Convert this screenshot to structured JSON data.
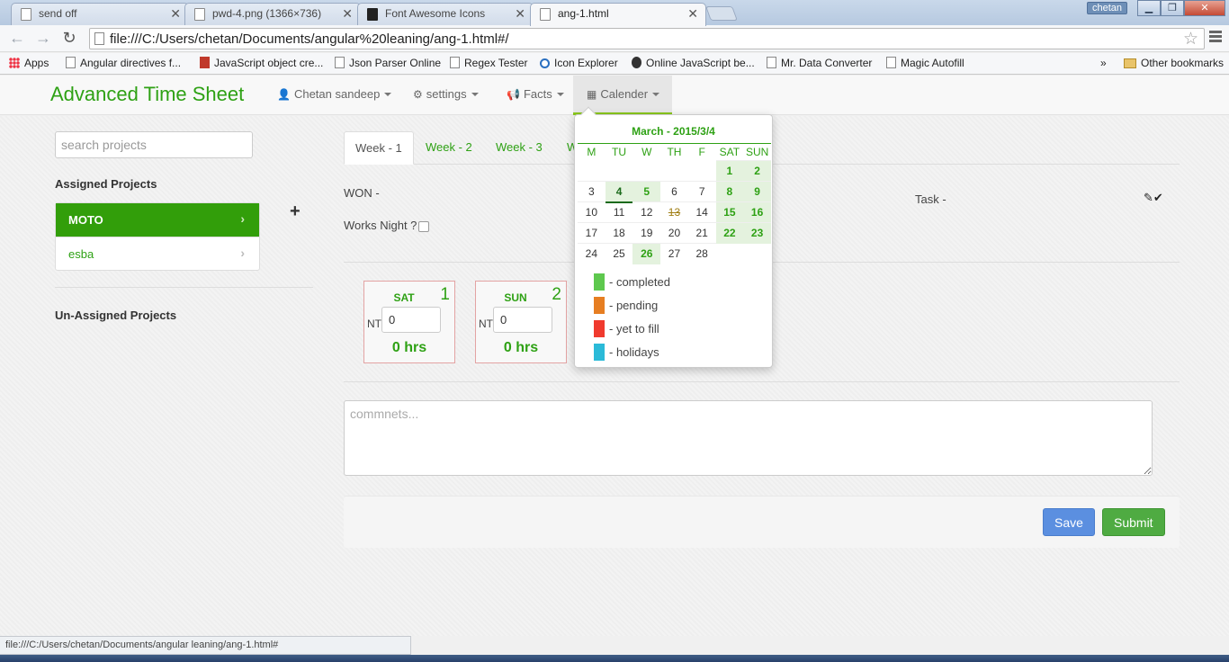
{
  "browser": {
    "tabs": [
      {
        "title": "send off"
      },
      {
        "title": "pwd-4.png (1366×736)"
      },
      {
        "title": "Font Awesome Icons"
      },
      {
        "title": "ang-1.html"
      }
    ],
    "profile_name": "chetan",
    "url": "file:///C:/Users/chetan/Documents/angular%20leaning/ang-1.html#/",
    "bookmarks": [
      "Apps",
      "Angular directives f...",
      "JavaScript object cre...",
      "Json Parser Online",
      "Regex Tester",
      "Icon Explorer",
      "Online JavaScript be...",
      "Mr. Data Converter",
      "Magic Autofill"
    ],
    "bookmarks_overflow": "»",
    "other_bookmarks": "Other bookmarks"
  },
  "app": {
    "brand": "Advanced Time Sheet",
    "nav": {
      "user": "Chetan sandeep",
      "settings": "settings",
      "facts": "Facts",
      "calender": "Calender"
    }
  },
  "sidebar": {
    "search_placeholder": "search projects",
    "assigned_heading": "Assigned Projects",
    "projects": [
      "MOTO",
      "esba"
    ],
    "unassigned_heading": "Un-Assigned Projects"
  },
  "main": {
    "tabs": [
      "Week - 1",
      "Week - 2",
      "Week - 3",
      "W"
    ],
    "won_label": "WON -",
    "task_label": "Task -",
    "works_night_label": "Works Night ?",
    "days": [
      {
        "name": "SAT",
        "num": "1",
        "nt": "NT",
        "value": "0",
        "hrs": "0 hrs"
      },
      {
        "name": "SUN",
        "num": "2",
        "nt": "NT",
        "value": "0",
        "hrs": "0 hrs"
      }
    ],
    "comments_placeholder": "commnets...",
    "save_label": "Save",
    "submit_label": "Submit"
  },
  "calendar": {
    "title": "March - 2015/3/4",
    "weekdays": [
      "M",
      "TU",
      "W",
      "TH",
      "F",
      "SAT",
      "SUN"
    ],
    "weeks": [
      [
        "",
        "",
        "",
        "",
        "",
        "1",
        "2"
      ],
      [
        "3",
        "4",
        "5",
        "6",
        "7",
        "8",
        "9"
      ],
      [
        "10",
        "11",
        "12",
        "13",
        "14",
        "15",
        "16"
      ],
      [
        "17",
        "18",
        "19",
        "20",
        "21",
        "22",
        "23"
      ],
      [
        "24",
        "25",
        "26",
        "27",
        "28",
        "",
        ""
      ]
    ],
    "legend": [
      {
        "label": "- completed",
        "color": "#5ec84e"
      },
      {
        "label": "- pending",
        "color": "#e67e22"
      },
      {
        "label": "- yet to fill",
        "color": "#f03a2e"
      },
      {
        "label": "- holidays",
        "color": "#2bbad8"
      }
    ]
  },
  "status_url": "file:///C:/Users/chetan/Documents/angular leaning/ang-1.html#"
}
